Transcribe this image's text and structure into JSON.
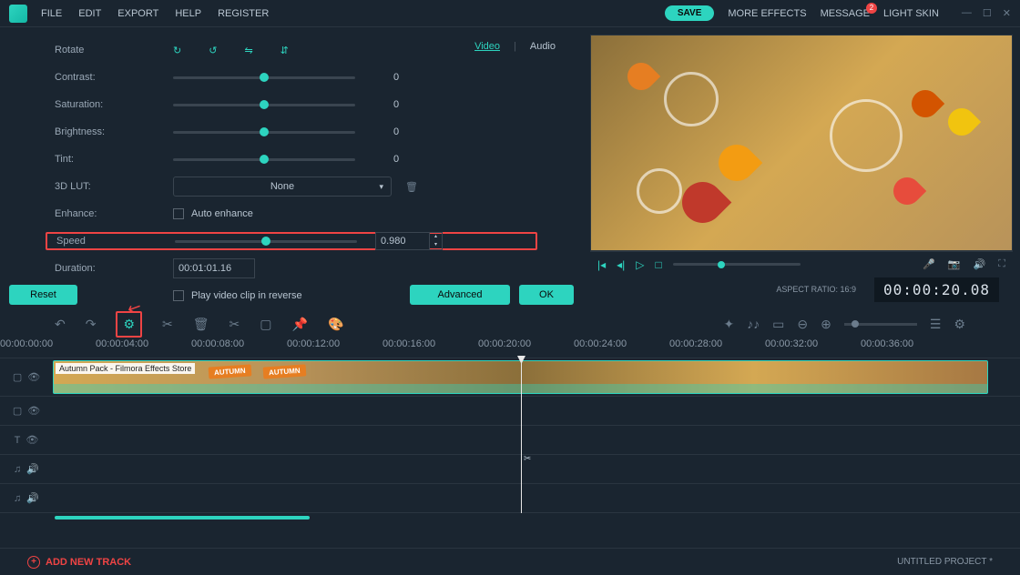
{
  "menu": {
    "file": "FILE",
    "edit": "EDIT",
    "export": "EXPORT",
    "help": "HELP",
    "register": "REGISTER"
  },
  "topbar": {
    "save": "SAVE",
    "more_effects": "MORE EFFECTS",
    "message": "MESSAGE",
    "message_badge": "2",
    "light_skin": "LIGHT SKIN"
  },
  "tabs": {
    "video": "Video",
    "audio": "Audio"
  },
  "props": {
    "rotate": "Rotate",
    "contrast": {
      "label": "Contrast:",
      "value": "0"
    },
    "saturation": {
      "label": "Saturation:",
      "value": "0"
    },
    "brightness": {
      "label": "Brightness:",
      "value": "0"
    },
    "tint": {
      "label": "Tint:",
      "value": "0"
    },
    "lut": {
      "label": "3D LUT:",
      "value": "None"
    },
    "enhance": {
      "label": "Enhance:",
      "checkbox": "Auto enhance"
    },
    "speed": {
      "label": "Speed",
      "value": "0.980"
    },
    "duration": {
      "label": "Duration:",
      "value": "00:01:01.16"
    },
    "reverse": "Play video clip in reverse"
  },
  "buttons": {
    "reset": "Reset",
    "advanced": "Advanced",
    "ok": "OK"
  },
  "info": {
    "aspect": "ASPECT RATIO: 16:9",
    "timecode": "00:00:20.08"
  },
  "ruler": {
    "t0": "00:00:00:00",
    "t1": "00:00:04:00",
    "t2": "00:00:08:00",
    "t3": "00:00:12:00",
    "t4": "00:00:16:00",
    "t5": "00:00:20:00",
    "t6": "00:00:24:00",
    "t7": "00:00:28:00",
    "t8": "00:00:32:00",
    "t9": "00:00:36:00"
  },
  "clip": {
    "label": "Autumn Pack - Filmora Effects Store",
    "tag": "AUTUMN"
  },
  "footer": {
    "add": "ADD NEW TRACK",
    "project": "UNTITLED PROJECT *"
  }
}
